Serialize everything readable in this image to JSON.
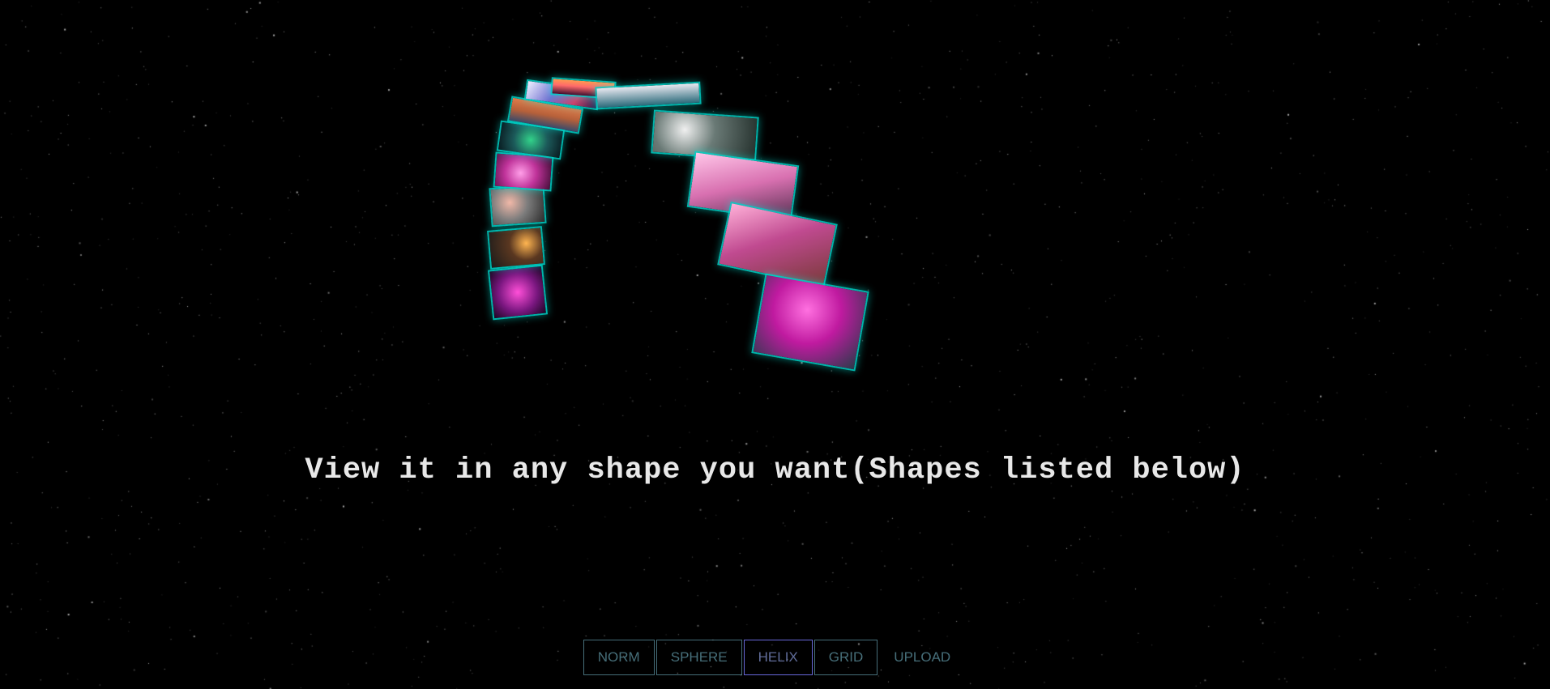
{
  "tagline": "View it in any shape you want(Shapes listed below)",
  "menu": {
    "items": [
      {
        "label": "NORM",
        "active": false
      },
      {
        "label": "SPHERE",
        "active": false
      },
      {
        "label": "HELIX",
        "active": true
      },
      {
        "label": "GRID",
        "active": false
      },
      {
        "label": "UPLOAD",
        "active": false
      }
    ]
  },
  "colors": {
    "background": "#000000",
    "tile_border": "#00d2c8",
    "tagline": "#e8e8e8",
    "button_border": "#7fc8dc",
    "button_active_border": "#6e6ee6"
  },
  "gallery": {
    "photos": [
      {
        "subject": "pink-blossom-tree"
      },
      {
        "subject": "candle-lights"
      },
      {
        "subject": "gray-shell"
      },
      {
        "subject": "pink-orchid"
      },
      {
        "subject": "peacock-feathers"
      },
      {
        "subject": "sunset-reef"
      },
      {
        "subject": "colorful-crowd"
      },
      {
        "subject": "sunset-silhouette"
      },
      {
        "subject": "teal-sky"
      },
      {
        "subject": "white-flowers"
      },
      {
        "subject": "pink-cherry-trees"
      },
      {
        "subject": "pink-blossom-branch"
      },
      {
        "subject": "pink-pom-pom-flowers"
      }
    ]
  }
}
